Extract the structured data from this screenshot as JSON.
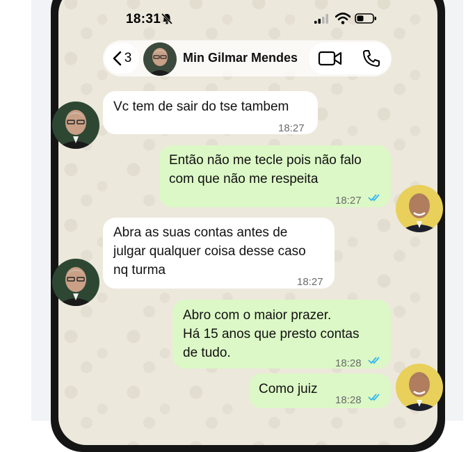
{
  "status_bar": {
    "time": "18:31"
  },
  "header": {
    "back_count": "3",
    "contact_name": "Min Gilmar Mendes"
  },
  "messages": [
    {
      "direction": "incoming",
      "text": "Vc tem de sair do tse tambem",
      "time": "18:27"
    },
    {
      "direction": "outgoing",
      "text": "Então não me tecle pois não falo\ncom que não me respeita",
      "time": "18:27",
      "read": true
    },
    {
      "direction": "incoming",
      "text": "Abra as suas contas antes de\njulgar qualquer coisa desse caso\nnq turma",
      "time": "18:27"
    },
    {
      "direction": "outgoing",
      "text": "Abro com o maior prazer.\nHá 15 anos que presto contas\nde tudo.",
      "time": "18:28",
      "read": true
    },
    {
      "direction": "outgoing",
      "text": "Como juiz",
      "time": "18:28",
      "read": true
    }
  ],
  "colors": {
    "incoming_bubble": "#ffffff",
    "outgoing_bubble": "#dcf8c6",
    "read_ticks": "#34b7f1",
    "chat_background": "#ece8dc"
  },
  "icons": [
    "bell-muted-icon",
    "signal-icon",
    "wifi-icon",
    "battery-icon",
    "chevron-left-icon",
    "video-call-icon",
    "phone-call-icon",
    "double-check-icon"
  ]
}
